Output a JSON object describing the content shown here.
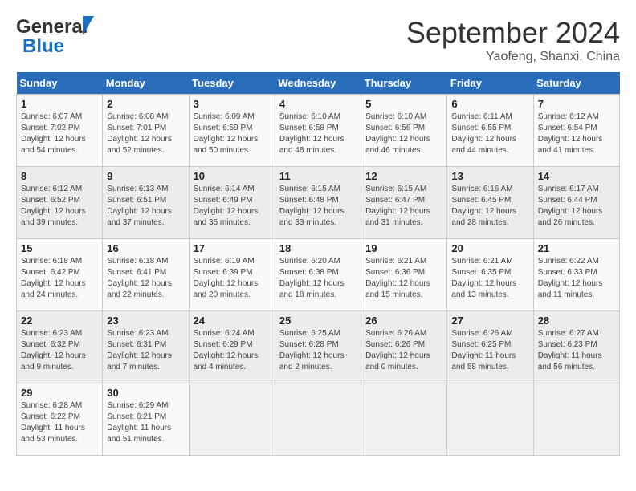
{
  "header": {
    "logo_line1": "General",
    "logo_line2": "Blue",
    "month_title": "September 2024",
    "location": "Yaofeng, Shanxi, China"
  },
  "calendar": {
    "days_of_week": [
      "Sunday",
      "Monday",
      "Tuesday",
      "Wednesday",
      "Thursday",
      "Friday",
      "Saturday"
    ],
    "weeks": [
      [
        null,
        {
          "day": "2",
          "sunrise": "Sunrise: 6:08 AM",
          "sunset": "Sunset: 7:01 PM",
          "daylight": "Daylight: 12 hours and 52 minutes."
        },
        {
          "day": "3",
          "sunrise": "Sunrise: 6:09 AM",
          "sunset": "Sunset: 6:59 PM",
          "daylight": "Daylight: 12 hours and 50 minutes."
        },
        {
          "day": "4",
          "sunrise": "Sunrise: 6:10 AM",
          "sunset": "Sunset: 6:58 PM",
          "daylight": "Daylight: 12 hours and 48 minutes."
        },
        {
          "day": "5",
          "sunrise": "Sunrise: 6:10 AM",
          "sunset": "Sunset: 6:56 PM",
          "daylight": "Daylight: 12 hours and 46 minutes."
        },
        {
          "day": "6",
          "sunrise": "Sunrise: 6:11 AM",
          "sunset": "Sunset: 6:55 PM",
          "daylight": "Daylight: 12 hours and 44 minutes."
        },
        {
          "day": "7",
          "sunrise": "Sunrise: 6:12 AM",
          "sunset": "Sunset: 6:54 PM",
          "daylight": "Daylight: 12 hours and 41 minutes."
        }
      ],
      [
        {
          "day": "1",
          "sunrise": "Sunrise: 6:07 AM",
          "sunset": "Sunset: 7:02 PM",
          "daylight": "Daylight: 12 hours and 54 minutes."
        },
        {
          "day": "9",
          "sunrise": "Sunrise: 6:13 AM",
          "sunset": "Sunset: 6:51 PM",
          "daylight": "Daylight: 12 hours and 37 minutes."
        },
        {
          "day": "10",
          "sunrise": "Sunrise: 6:14 AM",
          "sunset": "Sunset: 6:49 PM",
          "daylight": "Daylight: 12 hours and 35 minutes."
        },
        {
          "day": "11",
          "sunrise": "Sunrise: 6:15 AM",
          "sunset": "Sunset: 6:48 PM",
          "daylight": "Daylight: 12 hours and 33 minutes."
        },
        {
          "day": "12",
          "sunrise": "Sunrise: 6:15 AM",
          "sunset": "Sunset: 6:47 PM",
          "daylight": "Daylight: 12 hours and 31 minutes."
        },
        {
          "day": "13",
          "sunrise": "Sunrise: 6:16 AM",
          "sunset": "Sunset: 6:45 PM",
          "daylight": "Daylight: 12 hours and 28 minutes."
        },
        {
          "day": "14",
          "sunrise": "Sunrise: 6:17 AM",
          "sunset": "Sunset: 6:44 PM",
          "daylight": "Daylight: 12 hours and 26 minutes."
        }
      ],
      [
        {
          "day": "8",
          "sunrise": "Sunrise: 6:12 AM",
          "sunset": "Sunset: 6:52 PM",
          "daylight": "Daylight: 12 hours and 39 minutes."
        },
        {
          "day": "16",
          "sunrise": "Sunrise: 6:18 AM",
          "sunset": "Sunset: 6:41 PM",
          "daylight": "Daylight: 12 hours and 22 minutes."
        },
        {
          "day": "17",
          "sunrise": "Sunrise: 6:19 AM",
          "sunset": "Sunset: 6:39 PM",
          "daylight": "Daylight: 12 hours and 20 minutes."
        },
        {
          "day": "18",
          "sunrise": "Sunrise: 6:20 AM",
          "sunset": "Sunset: 6:38 PM",
          "daylight": "Daylight: 12 hours and 18 minutes."
        },
        {
          "day": "19",
          "sunrise": "Sunrise: 6:21 AM",
          "sunset": "Sunset: 6:36 PM",
          "daylight": "Daylight: 12 hours and 15 minutes."
        },
        {
          "day": "20",
          "sunrise": "Sunrise: 6:21 AM",
          "sunset": "Sunset: 6:35 PM",
          "daylight": "Daylight: 12 hours and 13 minutes."
        },
        {
          "day": "21",
          "sunrise": "Sunrise: 6:22 AM",
          "sunset": "Sunset: 6:33 PM",
          "daylight": "Daylight: 12 hours and 11 minutes."
        }
      ],
      [
        {
          "day": "15",
          "sunrise": "Sunrise: 6:18 AM",
          "sunset": "Sunset: 6:42 PM",
          "daylight": "Daylight: 12 hours and 24 minutes."
        },
        {
          "day": "23",
          "sunrise": "Sunrise: 6:23 AM",
          "sunset": "Sunset: 6:31 PM",
          "daylight": "Daylight: 12 hours and 7 minutes."
        },
        {
          "day": "24",
          "sunrise": "Sunrise: 6:24 AM",
          "sunset": "Sunset: 6:29 PM",
          "daylight": "Daylight: 12 hours and 4 minutes."
        },
        {
          "day": "25",
          "sunrise": "Sunrise: 6:25 AM",
          "sunset": "Sunset: 6:28 PM",
          "daylight": "Daylight: 12 hours and 2 minutes."
        },
        {
          "day": "26",
          "sunrise": "Sunrise: 6:26 AM",
          "sunset": "Sunset: 6:26 PM",
          "daylight": "Daylight: 12 hours and 0 minutes."
        },
        {
          "day": "27",
          "sunrise": "Sunrise: 6:26 AM",
          "sunset": "Sunset: 6:25 PM",
          "daylight": "Daylight: 11 hours and 58 minutes."
        },
        {
          "day": "28",
          "sunrise": "Sunrise: 6:27 AM",
          "sunset": "Sunset: 6:23 PM",
          "daylight": "Daylight: 11 hours and 56 minutes."
        }
      ],
      [
        {
          "day": "22",
          "sunrise": "Sunrise: 6:23 AM",
          "sunset": "Sunset: 6:32 PM",
          "daylight": "Daylight: 12 hours and 9 minutes."
        },
        {
          "day": "30",
          "sunrise": "Sunrise: 6:29 AM",
          "sunset": "Sunset: 6:21 PM",
          "daylight": "Daylight: 11 hours and 51 minutes."
        },
        null,
        null,
        null,
        null,
        null
      ],
      [
        {
          "day": "29",
          "sunrise": "Sunrise: 6:28 AM",
          "sunset": "Sunset: 6:22 PM",
          "daylight": "Daylight: 11 hours and 53 minutes."
        },
        null,
        null,
        null,
        null,
        null,
        null
      ]
    ]
  }
}
